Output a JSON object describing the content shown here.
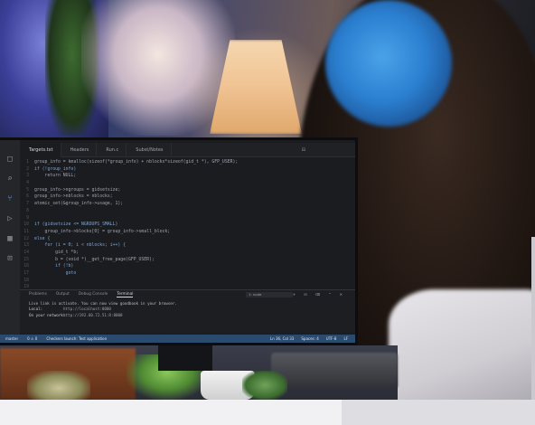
{
  "editor": {
    "tabs": [
      "Targets.txt",
      "Headers",
      "Run.c",
      "Subst/Notes"
    ],
    "active_tab": 0,
    "code_lines": [
      {
        "n": "1",
        "text": "group_info = kmalloc(sizeof(*group_info) + nblocks*sizeof(gid_t *), GFP_USER);",
        "kw": false
      },
      {
        "n": "2",
        "text": "if (!group_info)",
        "kw": true
      },
      {
        "n": "3",
        "text": "    return NULL;",
        "kw": false
      },
      {
        "n": "4",
        "text": "",
        "kw": false
      },
      {
        "n": "5",
        "text": "group_info->ngroups = gidsetsize;",
        "kw": false
      },
      {
        "n": "6",
        "text": "group_info->nblocks = nblocks;",
        "kw": false
      },
      {
        "n": "7",
        "text": "atomic_set(&group_info->usage, 1);",
        "kw": false
      },
      {
        "n": "8",
        "text": "",
        "kw": false
      },
      {
        "n": "9",
        "text": "",
        "kw": false
      },
      {
        "n": "10",
        "text": "if (gidsetsize <= NGROUPS_SMALL)",
        "kw": true
      },
      {
        "n": "11",
        "text": "    group_info->blocks[0] = group_info->small_block;",
        "kw": false
      },
      {
        "n": "12",
        "text": "else {",
        "kw": true
      },
      {
        "n": "13",
        "text": "    for (i = 0; i < nblocks; i++) {",
        "kw": true
      },
      {
        "n": "14",
        "text": "        gid_t *b;",
        "kw": false
      },
      {
        "n": "15",
        "text": "        b = (void *)__get_free_page(GFP_USER);",
        "kw": false
      },
      {
        "n": "16",
        "text": "        if (!b)",
        "kw": true
      },
      {
        "n": "17",
        "text": "            goto",
        "kw": true
      },
      {
        "n": "18",
        "text": "",
        "kw": false
      },
      {
        "n": "19",
        "text": "",
        "kw": false
      }
    ]
  },
  "panel": {
    "tabs": [
      "Problems",
      "Output",
      "Debug Console",
      "Terminal"
    ],
    "active_tab": 3,
    "select": "1: node",
    "terminal": {
      "line1": "Live link is activate. You can now view goodbook in your browser.",
      "local_label": "Local:",
      "local_url": "http://localhost:8000",
      "network_label": "On your network:",
      "network_url": "http://192.60.72.51:8:8000"
    }
  },
  "statusbar": {
    "left": [
      "master",
      "0 ⚠ 0",
      "Checkers launch: Test application"
    ],
    "right": [
      "Ln 36, Col 33",
      "Spaces: 4",
      "UTF-8",
      "LF"
    ]
  }
}
